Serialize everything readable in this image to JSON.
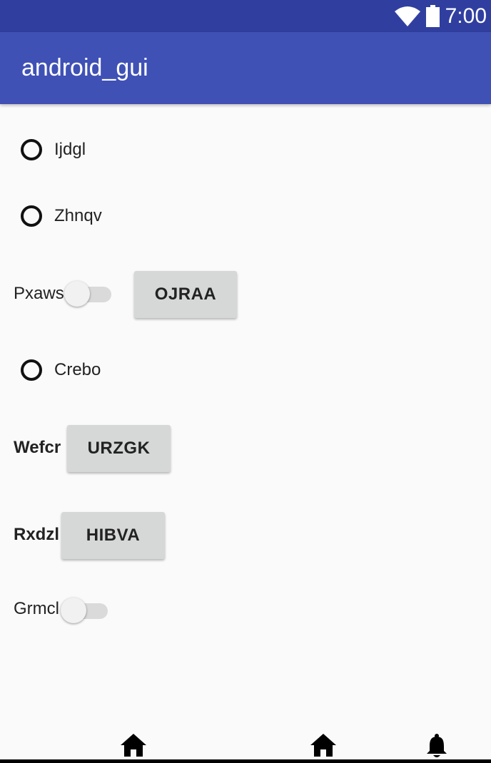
{
  "status_bar": {
    "time": "7:00",
    "icons": [
      "wifi-icon",
      "battery-icon"
    ],
    "color": "#303f9f"
  },
  "app_bar": {
    "title": "android_gui",
    "color": "#3f51b5"
  },
  "content": {
    "radio_1": {
      "label": "Ijdgl",
      "checked": false
    },
    "radio_2": {
      "label": "Zhnqv",
      "checked": false
    },
    "switch_1": {
      "label": "Pxaws",
      "on": false
    },
    "button_1": {
      "label": "OJRAA"
    },
    "radio_3": {
      "label": "Crebo",
      "checked": false
    },
    "row_wefcr": {
      "label": "Wefcr",
      "button": "URZGK"
    },
    "row_rxdzl": {
      "label": "Rxdzl",
      "button": "HIBVA"
    },
    "switch_2": {
      "label": "Grmcl",
      "on": false
    }
  },
  "bottom_nav": {
    "icons": [
      "home-icon",
      "home-icon",
      "bell-icon"
    ]
  }
}
